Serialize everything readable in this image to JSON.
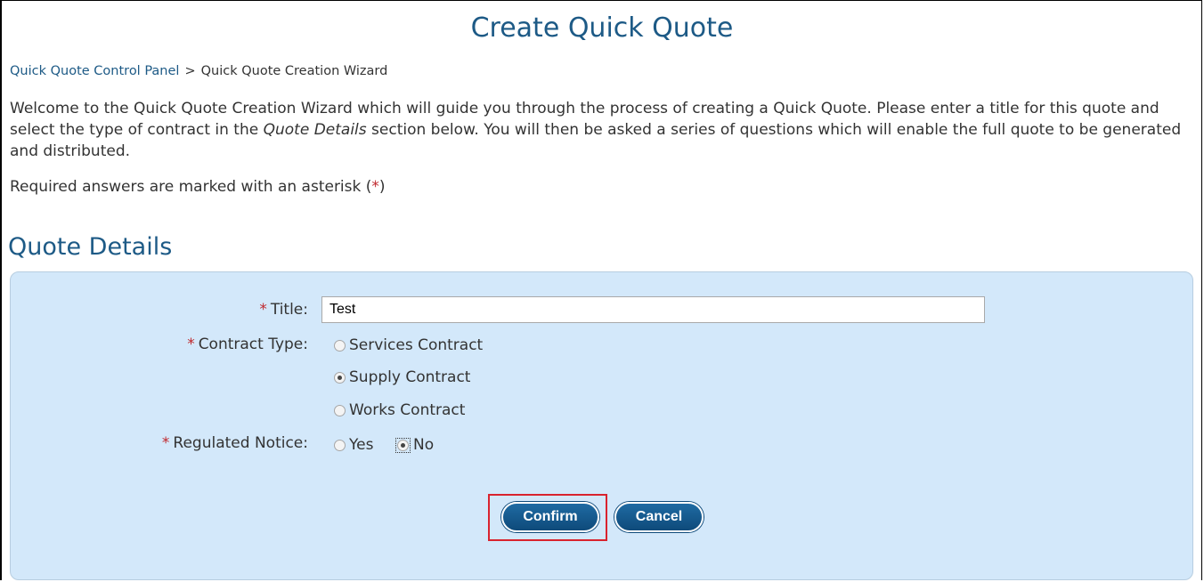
{
  "page": {
    "title": "Create Quick Quote"
  },
  "breadcrumb": {
    "link": "Quick Quote Control Panel",
    "separator": ">",
    "current": "Quick Quote Creation Wizard"
  },
  "intro": {
    "part1": "Welcome to the Quick Quote Creation Wizard which will guide you through the process of creating a Quick Quote. Please enter a title for this quote and select the type of contract in the ",
    "emphasis": "Quote Details",
    "part2": " section below. You will then be asked a series of questions which will enable the full quote to be generated and distributed."
  },
  "required_note": {
    "text_before": "Required answers are marked with an asterisk (",
    "asterisk": "*",
    "text_after": ")"
  },
  "section": {
    "title": "Quote Details"
  },
  "form": {
    "required_marker": "*",
    "title_label": "Title:",
    "title_value": "Test",
    "contract_type_label": "Contract Type:",
    "contract_options": [
      {
        "label": "Services Contract",
        "checked": false
      },
      {
        "label": "Supply Contract",
        "checked": true
      },
      {
        "label": "Works Contract",
        "checked": false
      }
    ],
    "regulated_label": "Regulated Notice:",
    "regulated_options": [
      {
        "label": "Yes",
        "checked": false
      },
      {
        "label": "No",
        "checked": true
      }
    ]
  },
  "buttons": {
    "confirm": "Confirm",
    "cancel": "Cancel"
  },
  "colors": {
    "heading": "#1d5a86",
    "panel_bg": "#d3e8fa",
    "asterisk": "#c0282d",
    "button_bg": "#0e4a7a",
    "highlight": "#d9232e"
  }
}
